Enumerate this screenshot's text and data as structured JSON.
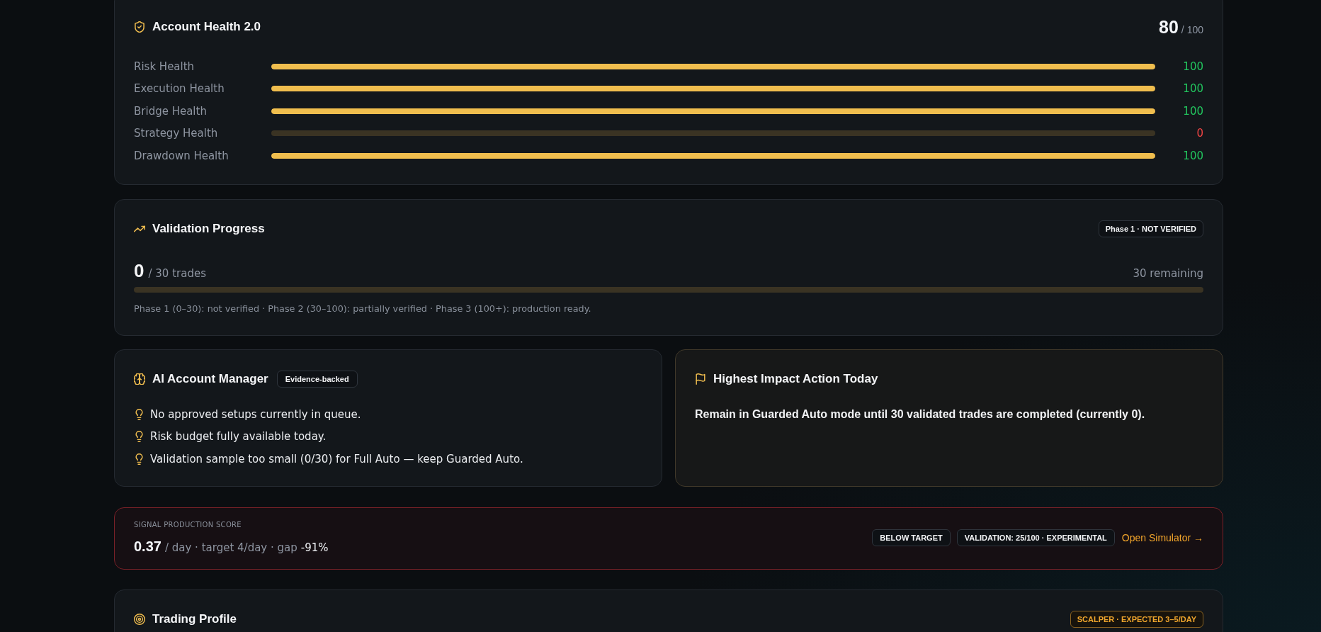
{
  "account_health": {
    "title": "Account Health 2.0",
    "score": "80",
    "score_max": "/ 100",
    "rows": [
      {
        "label": "Risk Health",
        "level": 1,
        "value": "100",
        "color": "#22c55e"
      },
      {
        "label": "Execution Health",
        "level": 1,
        "value": "100",
        "color": "#22c55e"
      },
      {
        "label": "Bridge Health",
        "level": 1,
        "value": "100",
        "color": "#22c55e"
      },
      {
        "label": "Strategy Health",
        "level": 0,
        "value": "0",
        "color": "#ef4444"
      },
      {
        "label": "Drawdown Health",
        "level": 1,
        "value": "100",
        "color": "#22c55e"
      }
    ]
  },
  "validation_progress": {
    "title": "Validation Progress",
    "badge": "Phase 1 · NOT VERIFIED",
    "count": "0",
    "count_suffix": "/ 30 trades",
    "remaining": "30 remaining",
    "level": 0,
    "note": "Phase 1 (0–30): not verified · Phase 2 (30–100): partially verified · Phase 3 (100+): production ready."
  },
  "ai_account_manager": {
    "title": "AI Account Manager",
    "badge": "Evidence-backed",
    "items": [
      "No approved setups currently in queue.",
      "Risk budget fully available today.",
      "Validation sample too small (0/30) for Full Auto — keep Guarded Auto."
    ]
  },
  "highest_impact_action": {
    "title": "Highest Impact Action Today",
    "text": "Remain in Guarded Auto mode until 30 validated trades are completed (currently 0)."
  },
  "signal_production_score": {
    "label": "SIGNAL PRODUCTION SCORE",
    "value": "0.37",
    "detail": "/ day · target 4/day · gap",
    "gap": "-91%",
    "badges": [
      "BELOW TARGET",
      "VALIDATION: 25/100 · EXPERIMENTAL"
    ],
    "link": "Open Simulator →"
  },
  "trading_profile": {
    "title": "Trading Profile",
    "badge": "SCALPER · EXPECTED 3–5/DAY"
  }
}
